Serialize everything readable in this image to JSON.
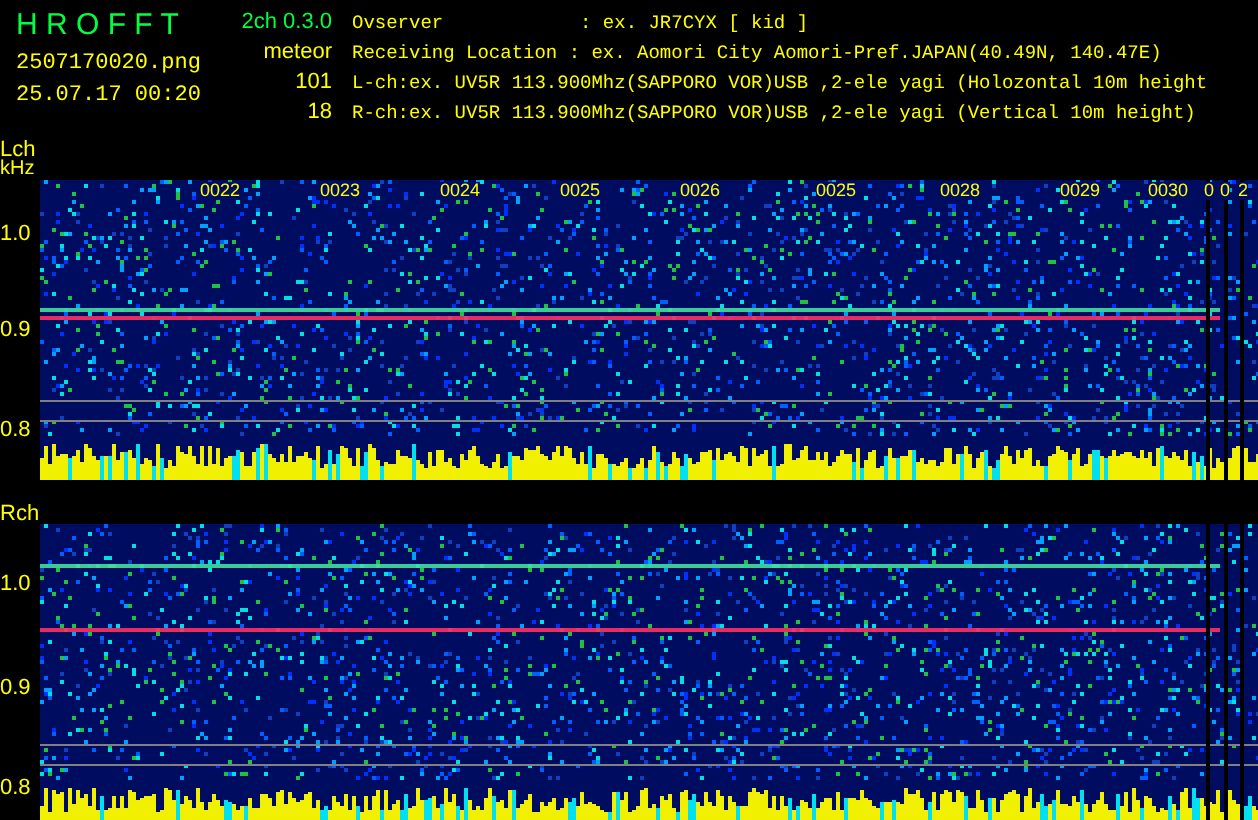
{
  "app": {
    "title": "H R O F F T",
    "version": "2ch 0.3.0",
    "file": "2507170020.png",
    "timestamp": "25.07.17 00:20",
    "mode": "meteor",
    "l_count": "101",
    "r_count": "18"
  },
  "info_lines": [
    "Ovserver            : ex. JR7CYX [ kid ]",
    "Receiving Location : ex. Aomori City Aomori-Pref.JAPAN(40.49N, 140.47E)",
    "L-ch:ex. UV5R 113.900Mhz(SAPPORO VOR)USB ,2-ele yagi (Holozontal 10m height",
    "R-ch:ex. UV5R 113.900Mhz(SAPPORO VOR)USB ,2-ele yagi (Vertical 10m height)"
  ],
  "channels": [
    {
      "label": "Lch",
      "unit": "kHz",
      "freq_labels": [
        "1.0",
        "0.9",
        "0.8"
      ],
      "time_labels": [
        "0022",
        "0023",
        "0024",
        "0025",
        "0026",
        "0025",
        "0028",
        "0029",
        "0030",
        "0",
        "0",
        "2"
      ]
    },
    {
      "label": "Rch",
      "freq_labels": [
        "1.0",
        "0.9",
        "0.8"
      ]
    }
  ]
}
